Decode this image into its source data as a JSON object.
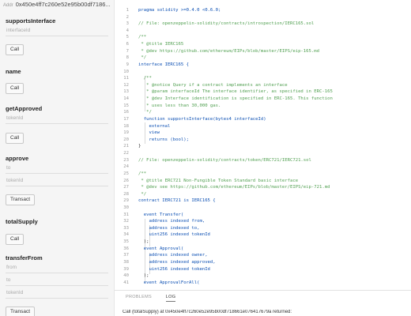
{
  "contract": {
    "address_label": "Addr",
    "address": "0x450e4ff7c260e52e95b00df7186..."
  },
  "functions": [
    {
      "name": "supportsInterface",
      "params": [
        "interfaceId"
      ],
      "button": "Call"
    },
    {
      "name": "name",
      "params": [],
      "button": "Call"
    },
    {
      "name": "getApproved",
      "params": [
        "tokenId"
      ],
      "button": "Call"
    },
    {
      "name": "approve",
      "params": [
        "to",
        "tokenId"
      ],
      "button": "Transact"
    },
    {
      "name": "totalSupply",
      "params": [],
      "button": "Call"
    },
    {
      "name": "transferFrom",
      "params": [
        "from",
        "to",
        "tokenId"
      ],
      "button": "Transact"
    }
  ],
  "editor": {
    "lines": [
      {
        "n": "1",
        "t": "pragma solidity >=0.4.0 <0.6.0;"
      },
      {
        "n": "2",
        "t": ""
      },
      {
        "n": "3",
        "t": "// File: openzeppelin-solidity/contracts/introspection/IERC165.sol"
      },
      {
        "n": "4",
        "t": ""
      },
      {
        "n": "5",
        "t": "/**"
      },
      {
        "n": "6",
        "t": " * @title IERC165"
      },
      {
        "n": "7",
        "t": " * @dev https://github.com/ethereum/EIPs/blob/master/EIPS/eip-165.md"
      },
      {
        "n": "8",
        "t": " */"
      },
      {
        "n": "9",
        "t": "interface IERC165 {"
      },
      {
        "n": "10",
        "t": ""
      },
      {
        "n": "11",
        "t": "  /**"
      },
      {
        "n": "12",
        "t": "   * @notice Query if a contract implements an interface"
      },
      {
        "n": "13",
        "t": "   * @param interfaceId The interface identifier, as specified in ERC-165"
      },
      {
        "n": "14",
        "t": "   * @dev Interface identification is specified in ERC-165. This function"
      },
      {
        "n": "15",
        "t": "   * uses less than 30,000 gas."
      },
      {
        "n": "16",
        "t": "   */"
      },
      {
        "n": "17",
        "t": "  function supportsInterface(bytes4 interfaceId)"
      },
      {
        "n": "18",
        "t": "    external"
      },
      {
        "n": "19",
        "t": "    view"
      },
      {
        "n": "20",
        "t": "    returns (bool);"
      },
      {
        "n": "21",
        "t": "}"
      },
      {
        "n": "22",
        "t": ""
      },
      {
        "n": "23",
        "t": "// File: openzeppelin-solidity/contracts/token/ERC721/IERC721.sol"
      },
      {
        "n": "24",
        "t": ""
      },
      {
        "n": "25",
        "t": "/**"
      },
      {
        "n": "26",
        "t": " * @title ERC721 Non-Fungible Token Standard basic interface"
      },
      {
        "n": "27",
        "t": " * @dev see https://github.com/ethereum/EIPs/blob/master/EIPS/eip-721.md"
      },
      {
        "n": "28",
        "t": " */"
      },
      {
        "n": "29",
        "t": "contract IERC721 is IERC165 {"
      },
      {
        "n": "30",
        "t": ""
      },
      {
        "n": "31",
        "t": "  event Transfer("
      },
      {
        "n": "32",
        "t": "    address indexed from,"
      },
      {
        "n": "33",
        "t": "    address indexed to,"
      },
      {
        "n": "34",
        "t": "    uint256 indexed tokenId"
      },
      {
        "n": "35",
        "t": "  );"
      },
      {
        "n": "36",
        "t": "  event Approval("
      },
      {
        "n": "37",
        "t": "    address indexed owner,"
      },
      {
        "n": "38",
        "t": "    address indexed approved,"
      },
      {
        "n": "39",
        "t": "    uint256 indexed tokenId"
      },
      {
        "n": "40",
        "t": "  );"
      },
      {
        "n": "41",
        "t": "  event ApprovalForAll("
      }
    ]
  },
  "panel": {
    "tabs": [
      "PROBLEMS",
      "LOG"
    ],
    "active_tab": "LOG",
    "log_message": "Call (totalSupply) at 0x450e4ff7c260e52e95b00df718661e076417679a returned:"
  }
}
